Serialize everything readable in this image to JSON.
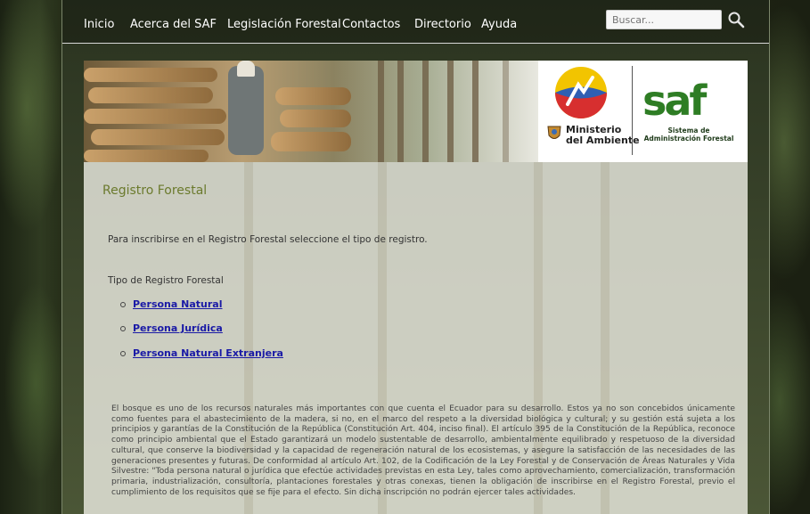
{
  "nav": {
    "items": [
      {
        "label": "Inicio"
      },
      {
        "label": "Acerca del SAF"
      },
      {
        "label": "Legislación Forestal"
      },
      {
        "label": "Contactos"
      },
      {
        "label": "Directorio"
      },
      {
        "label": "Ayuda"
      }
    ],
    "search_placeholder": "Buscar..."
  },
  "banner": {
    "ministry_line1": "Ministerio",
    "ministry_line2": "del Ambiente",
    "saf_logo_text": "saf",
    "saf_line1": "Sistema de",
    "saf_line2": "Administración Forestal"
  },
  "main": {
    "title": "Registro Forestal",
    "intro": "Para inscribirse en el Registro Forestal seleccione el tipo de registro.",
    "type_heading": "Tipo de Registro Forestal",
    "registry_types": [
      {
        "label": "Persona Natural"
      },
      {
        "label": "Persona Jurídica"
      },
      {
        "label": "Persona Natural Extranjera"
      }
    ],
    "paragraph": "El bosque es uno de los recursos naturales más importantes con que cuenta el Ecuador para su desarrollo. Estos ya no son concebidos únicamente como fuentes para el abastecimiento de la madera, si no, en el marco del respeto a la diversidad biológica y cultural; y su gestión está sujeta a los principios y garantías de la Constitución de la República (Constitución Art. 404, inciso final). El artículo 395 de la Constitución de la República, reconoce como principio ambiental que el Estado garantizará un modelo sustentable de desarrollo, ambientalmente equilibrado y respetuoso de la diversidad cultural, que conserve la biodiversidad y la capacidad de regeneración natural de los ecosistemas, y asegure la satisfacción de las necesidades de las generaciones presentes y futuras. De conformidad al artículo Art. 102, de la Codificación de la Ley Forestal y de Conservación de Áreas Naturales y Vida Silvestre: \"Toda persona natural o jurídica que efectúe actividades previstas en esta Ley, tales como aprovechamiento, comercialización, transformación primaria, industrialización, consultoría, plantaciones forestales y otras conexas, tienen la obligación de inscribirse en el Registro Forestal, previo el cumplimiento de los requisitos que se fije para el efecto. Sin dicha inscripción no podrán ejercer tales actividades."
  },
  "colors": {
    "title_green": "#6b7a2d",
    "link_blue": "#1a1aa6",
    "saf_green": "#2e7d24"
  }
}
